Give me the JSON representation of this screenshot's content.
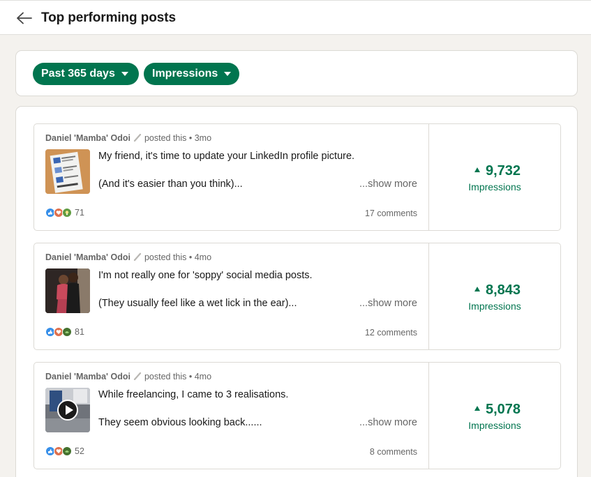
{
  "header": {
    "title": "Top performing posts"
  },
  "filters": {
    "date_range": "Past 365 days",
    "metric": "Impressions"
  },
  "posts": [
    {
      "author": "Daniel 'Mamba' Odoi",
      "action": "posted this",
      "age": "3mo",
      "line1": "My friend, it's time to update your LinkedIn profile picture.",
      "line2": "(And it's easier than you think)...",
      "show_more": "...show more",
      "reaction_count": "71",
      "comments": "17 comments",
      "metric_value": "9,732",
      "metric_label": "Impressions",
      "thumb_icon": "document-thumbnail",
      "reactions": [
        "like-icon",
        "love-icon",
        "insightful-icon"
      ]
    },
    {
      "author": "Daniel 'Mamba' Odoi",
      "action": "posted this",
      "age": "4mo",
      "line1": "I'm not really one for 'soppy' social media posts.",
      "line2": "(They usually feel like a wet lick in the ear)...",
      "show_more": "...show more",
      "reaction_count": "81",
      "comments": "12 comments",
      "metric_value": "8,843",
      "metric_label": "Impressions",
      "thumb_icon": "photo-thumbnail",
      "reactions": [
        "like-icon",
        "love-icon",
        "support-icon"
      ]
    },
    {
      "author": "Daniel 'Mamba' Odoi",
      "action": "posted this",
      "age": "4mo",
      "line1": "While freelancing, I came to 3 realisations.",
      "line2": "They seem obvious looking back......",
      "show_more": "...show more",
      "reaction_count": "52",
      "comments": "8 comments",
      "metric_value": "5,078",
      "metric_label": "Impressions",
      "thumb_icon": "video-thumbnail",
      "reactions": [
        "like-icon",
        "love-icon",
        "support-icon"
      ]
    }
  ],
  "colors": {
    "accent": "#01754f",
    "background": "#f4f2ee",
    "border": "#dcdad5",
    "muted": "#666666"
  }
}
